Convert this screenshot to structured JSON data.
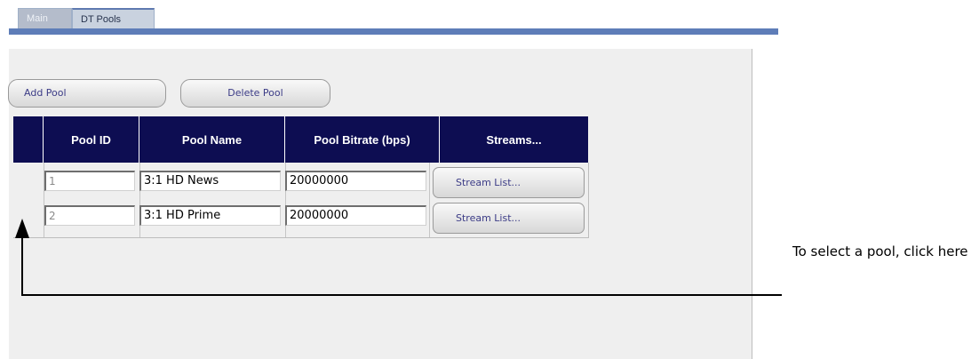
{
  "tabs": [
    {
      "label": "Main",
      "active": false
    },
    {
      "label": "DT Pools",
      "active": true
    }
  ],
  "toolbar": {
    "add_pool_label": "Add Pool",
    "delete_pool_label": "Delete Pool"
  },
  "table": {
    "columns": [
      "",
      "Pool ID",
      "Pool Name",
      "Pool Bitrate (bps)",
      "Streams..."
    ],
    "rows": [
      {
        "pool_id": "1",
        "pool_name": "3:1 HD News",
        "bitrate": "20000000",
        "streams_label": "Stream List..."
      },
      {
        "pool_id": "2",
        "pool_name": "3:1 HD Prime",
        "bitrate": "20000000",
        "streams_label": "Stream List..."
      }
    ]
  },
  "annotation": {
    "text": "To select a pool, click here"
  },
  "colors": {
    "header_bg": "#0d0d52",
    "tab_bar": "#5e7db8",
    "panel_bg": "#efefef",
    "button_text": "#3b3b86"
  }
}
